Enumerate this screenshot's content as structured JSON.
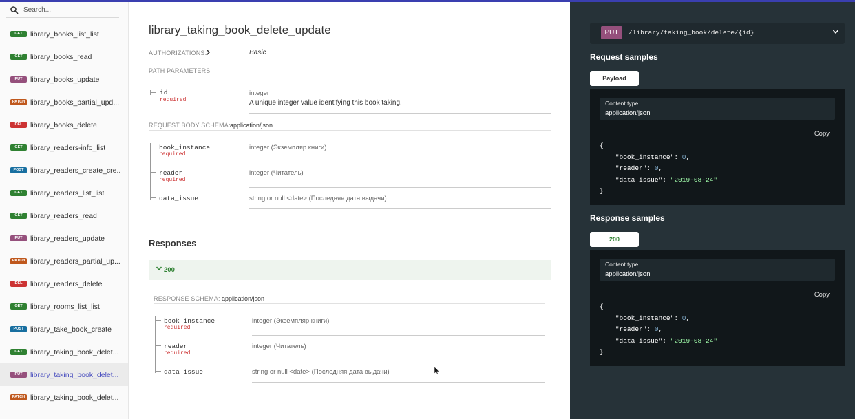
{
  "sidebar": {
    "search_placeholder": "Search...",
    "items": [
      {
        "method": "GET",
        "label": "library_books_list_list",
        "active": false
      },
      {
        "method": "GET",
        "label": "library_books_read",
        "active": false
      },
      {
        "method": "PUT",
        "label": "library_books_update",
        "active": false
      },
      {
        "method": "PATCH",
        "label": "library_books_partial_upd...",
        "active": false
      },
      {
        "method": "DEL",
        "label": "library_books_delete",
        "active": false
      },
      {
        "method": "GET",
        "label": "library_readers-info_list",
        "active": false
      },
      {
        "method": "POST",
        "label": "library_readers_create_cre...",
        "active": false
      },
      {
        "method": "GET",
        "label": "library_readers_list_list",
        "active": false
      },
      {
        "method": "GET",
        "label": "library_readers_read",
        "active": false
      },
      {
        "method": "PUT",
        "label": "library_readers_update",
        "active": false
      },
      {
        "method": "PATCH",
        "label": "library_readers_partial_up...",
        "active": false
      },
      {
        "method": "DEL",
        "label": "library_readers_delete",
        "active": false
      },
      {
        "method": "GET",
        "label": "library_rooms_list_list",
        "active": false
      },
      {
        "method": "POST",
        "label": "library_take_book_create",
        "active": false
      },
      {
        "method": "GET",
        "label": "library_taking_book_delet...",
        "active": false
      },
      {
        "method": "PUT",
        "label": "library_taking_book_delet...",
        "active": true
      },
      {
        "method": "PATCH",
        "label": "library_taking_book_delet...",
        "active": false
      }
    ]
  },
  "operation": {
    "title": "library_taking_book_delete_update",
    "authorizations_label": "AUTHORIZATIONS:",
    "authorizations_value": "Basic",
    "path_parameters_label": "PATH PARAMETERS",
    "path_param": {
      "name": "id",
      "required": "required",
      "type": "integer",
      "description": "A unique integer value identifying this book taking."
    },
    "request_body_label": "REQUEST BODY SCHEMA:",
    "request_body_media": "application/json",
    "request_fields": [
      {
        "name": "book_instance",
        "required": "required",
        "type": "integer (Экземпляр книги)"
      },
      {
        "name": "reader",
        "required": "required",
        "type": "integer (Читатель)"
      },
      {
        "name": "data_issue",
        "required": "",
        "type": "string or null <date> (Последняя дата выдачи)"
      }
    ],
    "responses_title": "Responses",
    "response_code": "200",
    "response_schema_label": "RESPONSE SCHEMA:",
    "response_media": "application/json",
    "response_fields": [
      {
        "name": "book_instance",
        "required": "required",
        "type": "integer (Экземпляр книги)"
      },
      {
        "name": "reader",
        "required": "required",
        "type": "integer (Читатель)"
      },
      {
        "name": "data_issue",
        "required": "",
        "type": "string or null <date> (Последняя дата выдачи)"
      }
    ]
  },
  "right_panel": {
    "method": "PUT",
    "path": "/library/taking_book/delete/{id}",
    "request_samples_title": "Request samples",
    "payload_tab": "Payload",
    "response_samples_title": "Response samples",
    "response_tab": "200",
    "content_type_label": "Content type",
    "content_type_value": "application/json",
    "copy_label": "Copy",
    "json_open": "{",
    "json_close": "}",
    "json_fields": [
      {
        "key": "\"book_instance\"",
        "value": "0",
        "kind": "number",
        "suffix": ","
      },
      {
        "key": "\"reader\"",
        "value": "0",
        "kind": "number",
        "suffix": ","
      },
      {
        "key": "\"data_issue\"",
        "value": "\"2019-08-24\"",
        "kind": "string",
        "suffix": ""
      }
    ]
  },
  "colors": {
    "accent": "#3a3fb0",
    "get": "#2f8132",
    "put": "#95507c",
    "patch": "#bf581d",
    "delete": "#cc3333",
    "post": "#186fa0",
    "right_panel_bg": "#263238",
    "required": "#cc3333"
  },
  "icons": {
    "search": "search-icon",
    "auth_expand": "chevron-right-icon",
    "endpoint_expand": "chevron-down-icon",
    "response_expand": "chevron-down-icon",
    "cursor": "mouse-pointer-icon"
  }
}
